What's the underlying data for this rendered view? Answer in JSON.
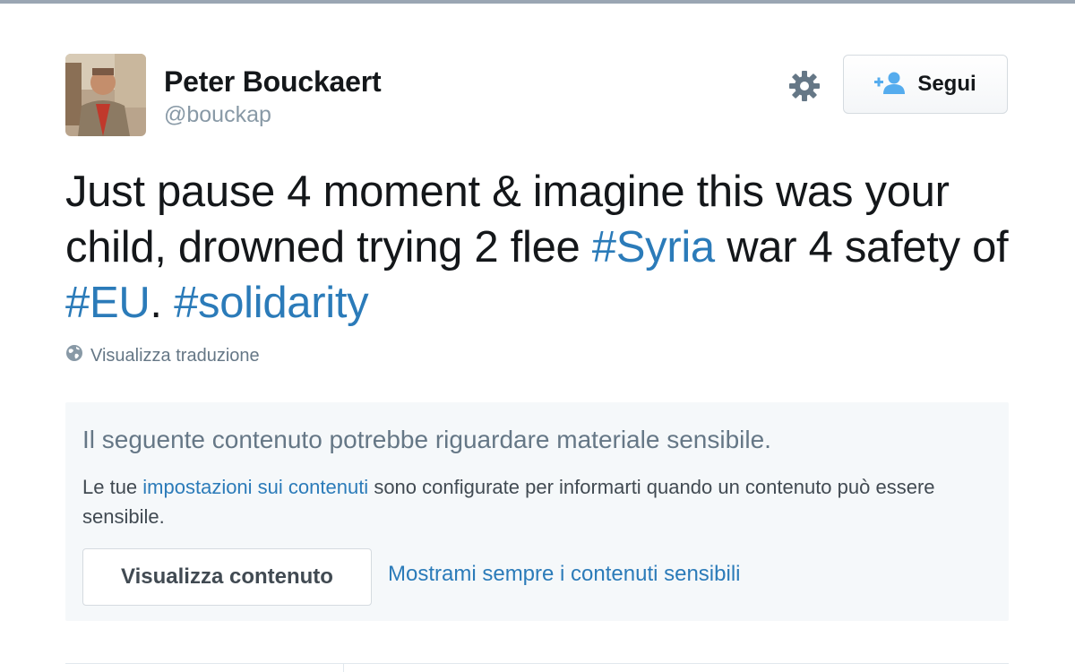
{
  "user": {
    "fullname": "Peter Bouckaert",
    "username": "@bouckap"
  },
  "actions": {
    "follow_label": "Segui"
  },
  "tweet": {
    "text_part1": "Just pause 4 moment & imagine this was your child, drowned trying 2 flee ",
    "hashtag_syria": "#Syria",
    "text_part2": " war 4 safety of ",
    "hashtag_eu": "#EU",
    "text_part3": ". ",
    "hashtag_solidarity": "#solidarity",
    "translate_label": "Visualizza traduzione"
  },
  "sensitive": {
    "title": "Il seguente contenuto potrebbe riguardare materiale sensibile.",
    "desc_prefix": "Le tue ",
    "settings_link": "impostazioni sui contenuti",
    "desc_suffix": " sono configurate per informarti quando un contenuto può essere sensibile.",
    "view_button": "Visualizza contenuto",
    "always_show_link": "Mostrami sempre i contenuti sensibili"
  },
  "colors": {
    "link": "#2b7bb9",
    "muted": "#8899a6",
    "panel_bg": "#f5f8fa"
  },
  "icons": {
    "settings": "gear-icon",
    "follow": "add-user-icon",
    "translate": "globe-icon"
  }
}
